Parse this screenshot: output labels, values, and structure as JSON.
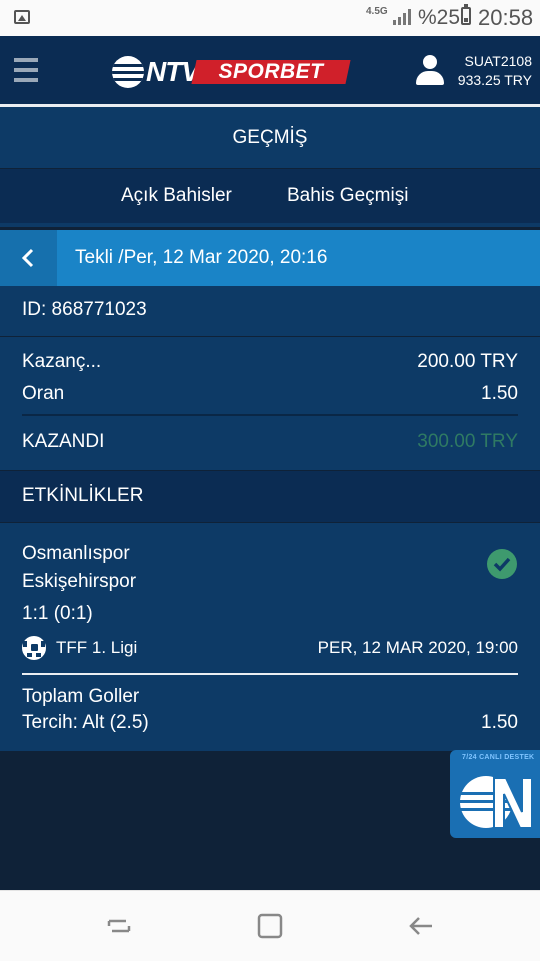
{
  "status_bar": {
    "network": "4.5G",
    "battery_percent": "%25",
    "time": "20:58"
  },
  "header": {
    "menu_icon": "hamburger-icon",
    "logo_ntv": "NTV",
    "logo_sporbet": "SPORBET",
    "username": "SUAT2108",
    "balance": "933.25 TRY",
    "brand_red": "#d0202a",
    "header_bg": "#0b2c53"
  },
  "page_title": "GEÇMİŞ",
  "tabs": [
    {
      "label": "Açık Bahisler"
    },
    {
      "label": "Bahis Geçmişi"
    }
  ],
  "detail": {
    "back_icon": "chevron-left-icon",
    "header_text": "Tekli /Per, 12 Mar 2020, 20:16",
    "bet_id": "ID: 868771023",
    "stake_label": "Kazanç...",
    "stake_value": "200.00 TRY",
    "odds_label": "Oran",
    "odds_value": "1.50",
    "result_label": "KAZANDI",
    "result_value": "300.00 TRY",
    "accent_blue": "#1a84c7",
    "win_green": "#2f7a63"
  },
  "events": {
    "section_title": "ETKİNLİKLER",
    "items": [
      {
        "home": "Osmanlıspor",
        "away": "Eskişehirspor",
        "score": "1:1 (0:1)",
        "status_icon": "check-circle-icon",
        "sport_icon": "soccer-ball-icon",
        "league": "TFF 1. Ligi",
        "datetime": "PER, 12 MAR 2020, 19:00",
        "market": "Toplam Goller",
        "selection": "Tercih: Alt (2.5)",
        "odds": "1.50"
      }
    ]
  },
  "support": {
    "caption": "7/24 CANLI DESTEK",
    "icon": "ntv-support-badge-icon"
  },
  "nav_bar": {
    "recent_icon": "recent-apps-icon",
    "home_icon": "home-icon",
    "back_icon": "back-arrow-icon"
  }
}
